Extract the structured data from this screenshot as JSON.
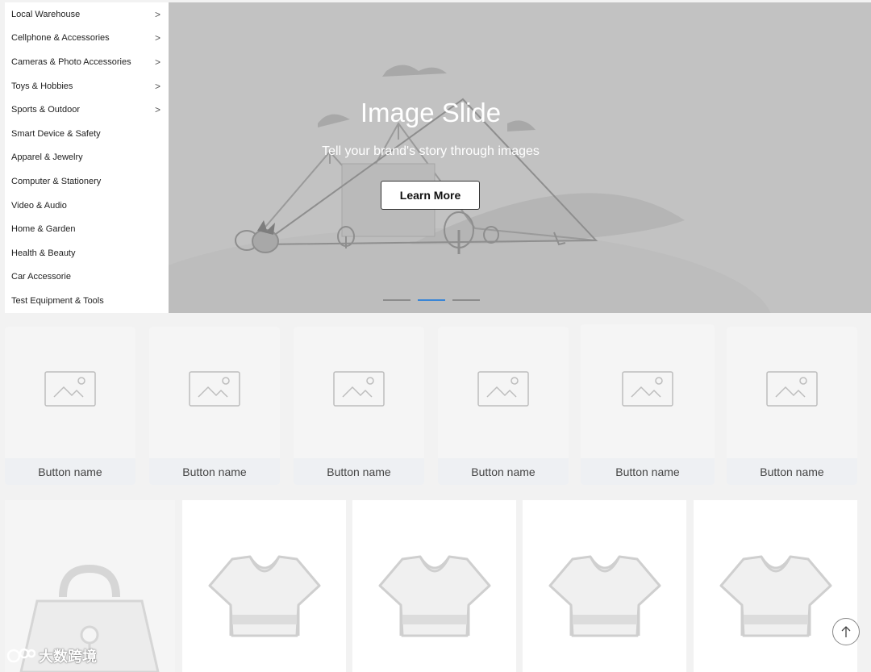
{
  "sidebar": {
    "items": [
      {
        "label": "Local Warehouse",
        "has_submenu": true
      },
      {
        "label": "Cellphone & Accessories",
        "has_submenu": true
      },
      {
        "label": "Cameras & Photo Accessories",
        "has_submenu": true
      },
      {
        "label": "Toys & Hobbies",
        "has_submenu": true
      },
      {
        "label": "Sports & Outdoor",
        "has_submenu": true
      },
      {
        "label": "Smart Device & Safety",
        "has_submenu": false
      },
      {
        "label": "Apparel & Jewelry",
        "has_submenu": false
      },
      {
        "label": "Computer & Stationery",
        "has_submenu": false
      },
      {
        "label": "Video & Audio",
        "has_submenu": false
      },
      {
        "label": "Home & Garden",
        "has_submenu": false
      },
      {
        "label": "Health & Beauty",
        "has_submenu": false
      },
      {
        "label": "Car Accessorie",
        "has_submenu": false
      },
      {
        "label": "Test Equipment & Tools",
        "has_submenu": false
      }
    ],
    "chevron": ">"
  },
  "hero": {
    "title": "Image Slide",
    "subtitle": "Tell your brand's story through images",
    "button_label": "Learn More",
    "slide_count": 3,
    "active_slide": 2,
    "active_dot_color": "#3a86d6"
  },
  "buttons": [
    {
      "label": "Button name"
    },
    {
      "label": "Button name"
    },
    {
      "label": "Button name"
    },
    {
      "label": "Button name"
    },
    {
      "label": "Button name"
    },
    {
      "label": "Button name"
    }
  ],
  "products": [
    {
      "icon": "handbag-placeholder-icon"
    },
    {
      "icon": "tshirt-placeholder-icon"
    },
    {
      "icon": "tshirt-placeholder-icon"
    },
    {
      "icon": "tshirt-placeholder-icon"
    },
    {
      "icon": "tshirt-placeholder-icon"
    }
  ],
  "watermark": {
    "text": "大数跨境"
  },
  "scroll_top": {
    "icon": "arrow-up-icon"
  }
}
